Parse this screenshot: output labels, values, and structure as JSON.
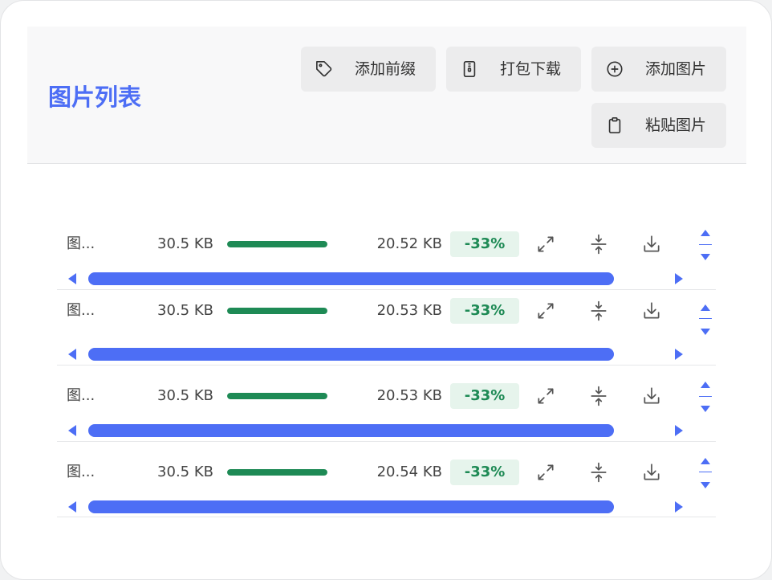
{
  "header": {
    "title": "图片列表",
    "add_prefix_label": "添加前缀",
    "pack_download_label": "打包下载",
    "add_image_label": "添加图片",
    "paste_image_label": "粘贴图片"
  },
  "images": [
    {
      "name": "图...",
      "original_size": "30.5 KB",
      "progress": 100,
      "compressed_size": "20.52 KB",
      "ratio": "-33%"
    },
    {
      "name": "图...",
      "original_size": "30.5 KB",
      "progress": 100,
      "compressed_size": "20.53 KB",
      "ratio": "-33%"
    },
    {
      "name": "图...",
      "original_size": "30.5 KB",
      "progress": 100,
      "compressed_size": "20.53 KB",
      "ratio": "-33%"
    },
    {
      "name": "图...",
      "original_size": "30.5 KB",
      "progress": 100,
      "compressed_size": "20.54 KB",
      "ratio": "-33%"
    }
  ],
  "icons": {
    "add_prefix": "tag-icon",
    "pack_download": "file-zip-icon",
    "add_image": "plus-circle-icon",
    "paste_image": "clipboard-icon",
    "row_actions": [
      "expand-icon",
      "compress-icon",
      "download-icon"
    ],
    "sort": [
      "sort-up-icon",
      "sort-down-icon"
    ],
    "scroll": [
      "scroll-left-icon",
      "scroll-right-icon"
    ]
  },
  "colors": {
    "accent": "#4d6ef5",
    "success": "#1e8a55",
    "success_bg": "#e6f4ec"
  }
}
